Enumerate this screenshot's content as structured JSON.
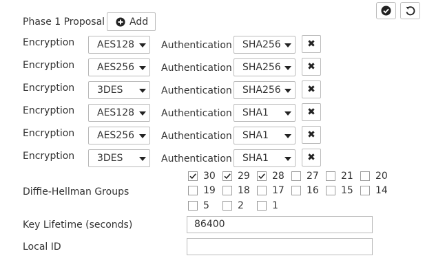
{
  "proposal": {
    "title": "Phase 1 Proposal",
    "add_label": "Add",
    "rows": [
      {
        "encryption_label": "Encryption",
        "encryption": "AES128",
        "auth_label": "Authentication",
        "auth": "SHA256"
      },
      {
        "encryption_label": "Encryption",
        "encryption": "AES256",
        "auth_label": "Authentication",
        "auth": "SHA256"
      },
      {
        "encryption_label": "Encryption",
        "encryption": "3DES",
        "auth_label": "Authentication",
        "auth": "SHA256"
      },
      {
        "encryption_label": "Encryption",
        "encryption": "AES128",
        "auth_label": "Authentication",
        "auth": "SHA1"
      },
      {
        "encryption_label": "Encryption",
        "encryption": "AES256",
        "auth_label": "Authentication",
        "auth": "SHA1"
      },
      {
        "encryption_label": "Encryption",
        "encryption": "3DES",
        "auth_label": "Authentication",
        "auth": "SHA1"
      }
    ]
  },
  "dh": {
    "label": "Diffie-Hellman Groups",
    "groups": [
      {
        "value": "30",
        "checked": true
      },
      {
        "value": "29",
        "checked": true
      },
      {
        "value": "28",
        "checked": true
      },
      {
        "value": "27",
        "checked": false
      },
      {
        "value": "21",
        "checked": false
      },
      {
        "value": "20",
        "checked": false
      },
      {
        "value": "19",
        "checked": false
      },
      {
        "value": "18",
        "checked": false
      },
      {
        "value": "17",
        "checked": false
      },
      {
        "value": "16",
        "checked": false
      },
      {
        "value": "15",
        "checked": false
      },
      {
        "value": "14",
        "checked": false
      },
      {
        "value": "5",
        "checked": false
      },
      {
        "value": "2",
        "checked": false
      },
      {
        "value": "1",
        "checked": false
      }
    ]
  },
  "key_lifetime": {
    "label": "Key Lifetime (seconds)",
    "value": "86400"
  },
  "local_id": {
    "label": "Local ID",
    "value": ""
  },
  "icons": {
    "apply": "check-circle-icon",
    "revert": "undo-icon",
    "add": "plus-circle-icon",
    "remove": "x-icon"
  }
}
